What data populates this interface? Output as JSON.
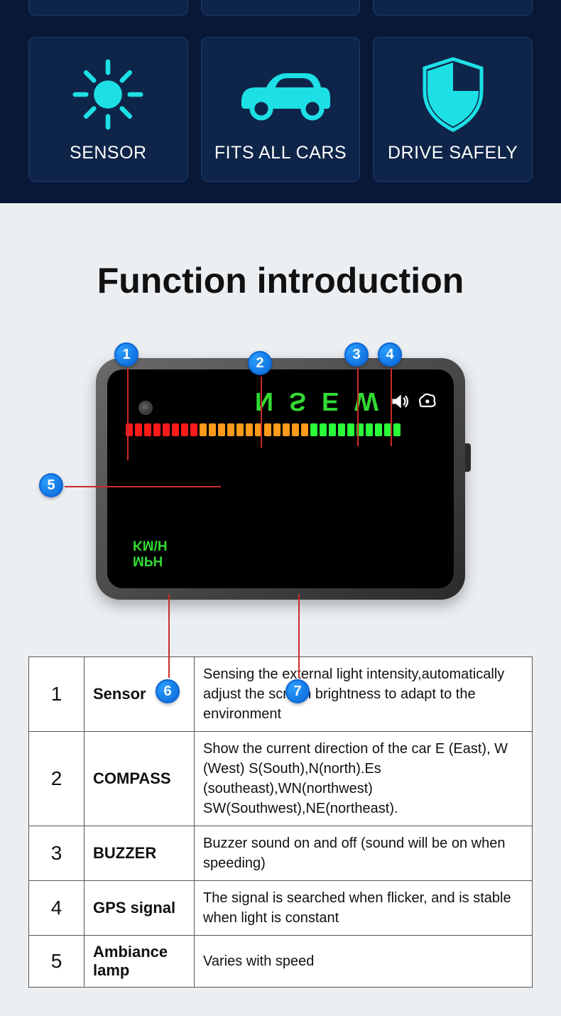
{
  "top_tiles": {
    "sensor": "SENSOR",
    "fits": "FITS ALL CARS",
    "drive": "DRIVE SAFELY"
  },
  "intro_title": "Function introduction",
  "markers": {
    "m1": "1",
    "m2": "2",
    "m3": "3",
    "m4": "4",
    "m5": "5",
    "m6": "6",
    "m7": "7"
  },
  "device": {
    "compass": "N S E W",
    "unit_mph": "MPH",
    "unit_kmh": "KM\\H"
  },
  "table": [
    {
      "num": "1",
      "name": "Sensor",
      "desc": "Sensing the external light intensity,automatically adjust the screen brightness to adapt to the environment"
    },
    {
      "num": "2",
      "name": "COMPASS",
      "desc": "Show the current direction of the car E (East), W (West) S(South),N(north).Es (southeast),WN(northwest) SW(Southwest),NE(northeast)."
    },
    {
      "num": "3",
      "name": "BUZZER",
      "desc": "Buzzer sound on and off (sound will be on when speeding)"
    },
    {
      "num": "4",
      "name": "GPS signal",
      "desc": "The signal is searched when flicker, and is stable when light is constant"
    },
    {
      "num": "5",
      "name": "Ambiance lamp",
      "desc": "Varies with speed"
    }
  ]
}
